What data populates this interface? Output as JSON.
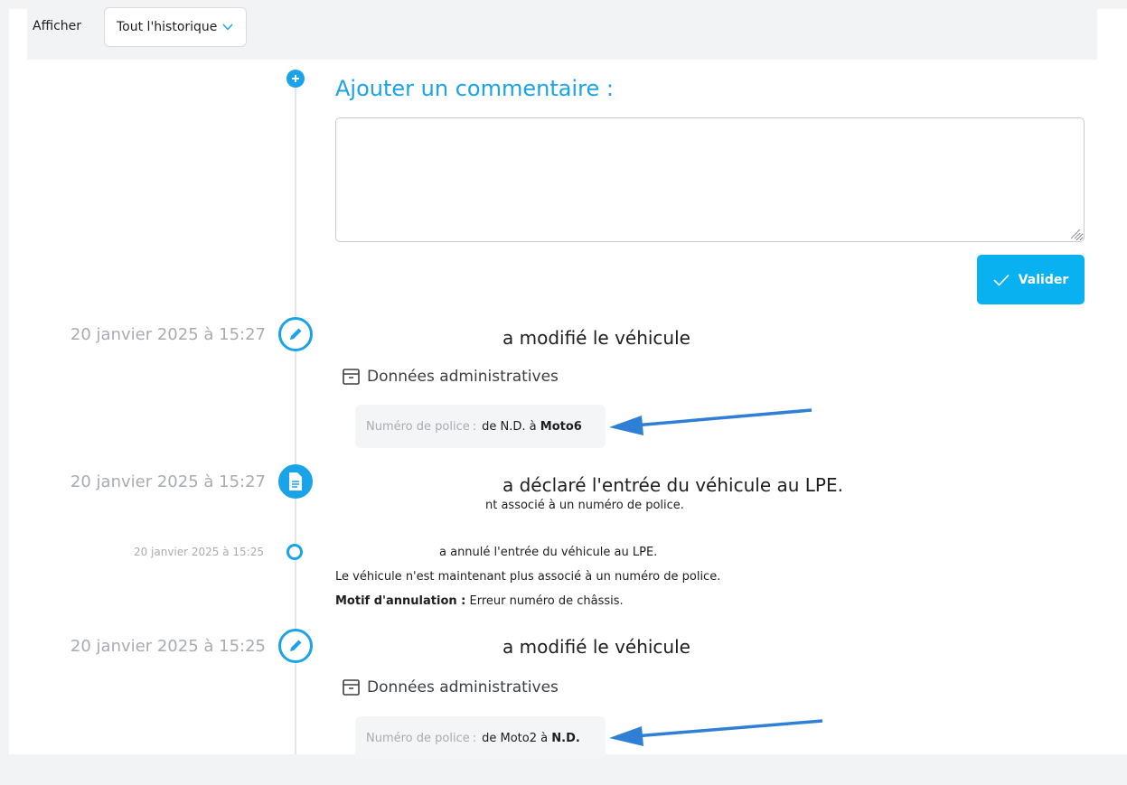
{
  "filter": {
    "label": "Afficher",
    "value": "Tout l'historique"
  },
  "comment": {
    "title": "Ajouter un commentaire :",
    "value": "",
    "submit_label": "Valider"
  },
  "events": [
    {
      "date": "20 janvier 2025 à 15:27",
      "heading": "a modifié le véhicule",
      "section": "Données administratives",
      "change": {
        "label": "Numéro de police",
        "prefix": "de",
        "from": "N.D.",
        "connector": "à",
        "to": "Moto6"
      }
    },
    {
      "date": "20 janvier 2025 à 15:27",
      "heading": "a déclaré l'entrée du véhicule au LPE.",
      "body": "nt associé à un numéro de police."
    },
    {
      "date": "20 janvier 2025 à 15:25",
      "heading": "a annulé l'entrée du véhicule au LPE.",
      "body": "Le véhicule n'est maintenant plus associé à un numéro de police.",
      "reason_label": "Motif d'annulation :",
      "reason": "Erreur numéro de châssis."
    },
    {
      "date": "20 janvier 2025 à 15:25",
      "heading": "a modifié le véhicule",
      "section": "Données administratives",
      "change": {
        "label": "Numéro de police",
        "prefix": "de",
        "from": "Moto2",
        "connector": "à",
        "to": "N.D."
      }
    }
  ],
  "colors": {
    "accent": "#1aa3e8",
    "button": "#0ab1f0",
    "annotation_arrow": "#2f7fd6"
  },
  "icons": {
    "filter_caret": "chevron-down-icon",
    "add": "plus-circle-icon",
    "edit": "pencil-icon",
    "document": "document-icon",
    "section": "archive-icon",
    "check": "check-icon"
  }
}
